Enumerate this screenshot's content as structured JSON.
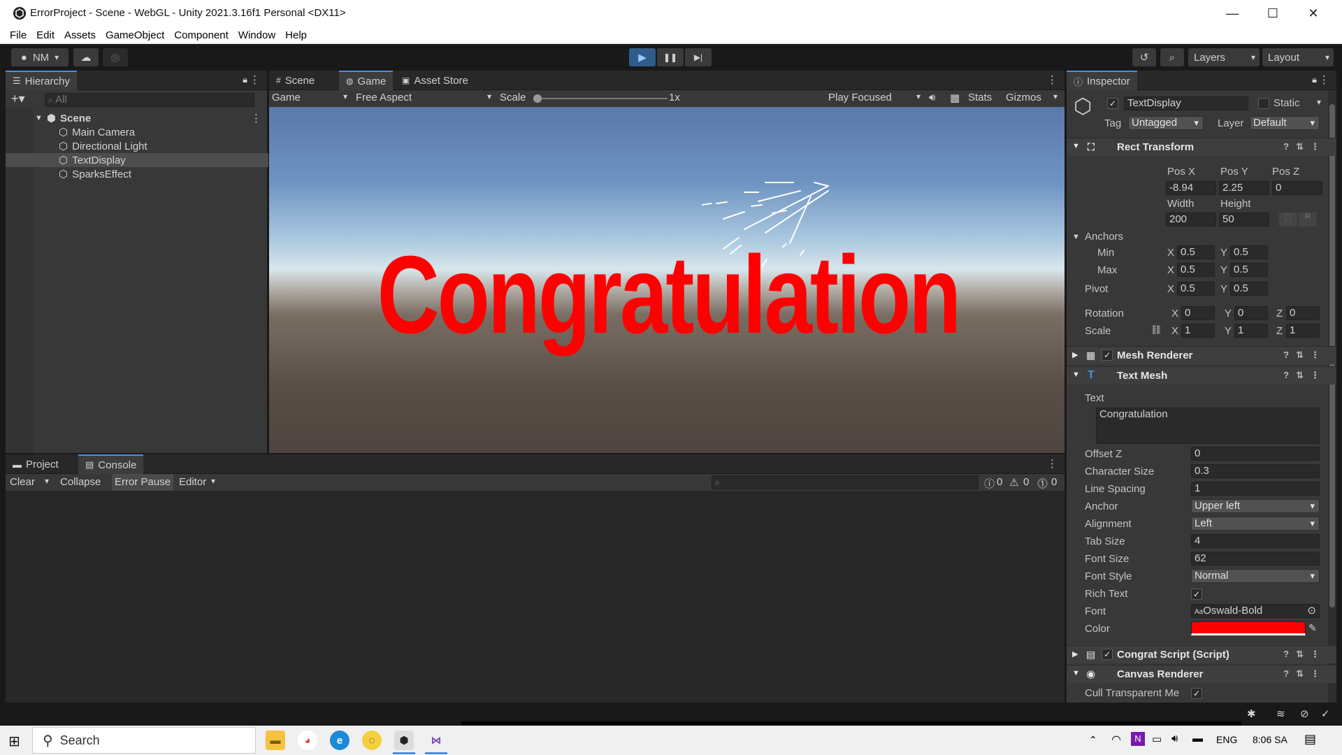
{
  "window": {
    "title": "ErrorProject - Scene - WebGL - Unity 2021.3.16f1 Personal <DX11>",
    "controls": {
      "minimize": "—",
      "maximize": "☐",
      "close": "✕"
    }
  },
  "menu": [
    "File",
    "Edit",
    "Assets",
    "GameObject",
    "Component",
    "Window",
    "Help"
  ],
  "toolbar": {
    "account": "NM",
    "layers": "Layers",
    "layout": "Layout",
    "play_icon": "▶",
    "pause_icon": "❚❚",
    "step_icon": "▶|"
  },
  "hierarchy": {
    "tab": "Hierarchy",
    "search_placeholder": "All",
    "scene": "Scene",
    "items": [
      "Main Camera",
      "Directional Light",
      "TextDisplay",
      "SparksEffect"
    ],
    "selected_index": 2
  },
  "game_view": {
    "tabs": [
      "Scene",
      "Game",
      "Asset Store"
    ],
    "active_tab": "Game",
    "display": "Game",
    "aspect": "Free Aspect",
    "scale_label": "Scale",
    "scale_value": "1x",
    "play_mode": "Play Focused",
    "stats": "Stats",
    "gizmos": "Gizmos",
    "rendered_text": "Congratulation"
  },
  "console": {
    "tabs": [
      "Project",
      "Console"
    ],
    "active_tab": "Console",
    "buttons": {
      "clear": "Clear",
      "collapse": "Collapse",
      "error_pause": "Error Pause",
      "editor": "Editor"
    },
    "counts": {
      "info": "0",
      "warning": "0",
      "error": "0"
    }
  },
  "inspector": {
    "tab": "Inspector",
    "object_name": "TextDisplay",
    "static_label": "Static",
    "tag_label": "Tag",
    "tag": "Untagged",
    "layer_label": "Layer",
    "layer": "Default",
    "rect_transform": {
      "title": "Rect Transform",
      "pos_x_label": "Pos X",
      "pos_y_label": "Pos Y",
      "pos_z_label": "Pos Z",
      "pos_x": "-8.94",
      "pos_y": "2.25",
      "pos_z": "0",
      "width_label": "Width",
      "height_label": "Height",
      "width": "200",
      "height": "50",
      "anchors_label": "Anchors",
      "min_label": "Min",
      "max_label": "Max",
      "min_x": "0.5",
      "min_y": "0.5",
      "max_x": "0.5",
      "max_y": "0.5",
      "pivot_label": "Pivot",
      "pivot_x": "0.5",
      "pivot_y": "0.5",
      "rotation_label": "Rotation",
      "rot_x": "0",
      "rot_y": "0",
      "rot_z": "0",
      "scale_label": "Scale",
      "scale_x": "1",
      "scale_y": "1",
      "scale_z": "1",
      "axis_x": "X",
      "axis_y": "Y",
      "axis_z": "Z"
    },
    "mesh_renderer": {
      "title": "Mesh Renderer"
    },
    "text_mesh": {
      "title": "Text Mesh",
      "text_label": "Text",
      "text": "Congratulation",
      "offset_z_label": "Offset Z",
      "offset_z": "0",
      "character_size_label": "Character Size",
      "character_size": "0.3",
      "line_spacing_label": "Line Spacing",
      "line_spacing": "1",
      "anchor_label": "Anchor",
      "anchor": "Upper left",
      "alignment_label": "Alignment",
      "alignment": "Left",
      "tab_size_label": "Tab Size",
      "tab_size": "4",
      "font_size_label": "Font Size",
      "font_size": "62",
      "font_style_label": "Font Style",
      "font_style": "Normal",
      "rich_text_label": "Rich Text",
      "font_label": "Font",
      "font": "Oswald-Bold",
      "color_label": "Color",
      "color": "#ff0000"
    },
    "congrat_script": {
      "title": "Congrat Script (Script)"
    },
    "canvas_renderer": {
      "title": "Canvas Renderer",
      "cull_label": "Cull Transparent Me"
    }
  },
  "taskbar": {
    "search": "Search",
    "lang": "ENG",
    "time": "8:06 SA"
  },
  "colors": {
    "accent": "#4a90e2",
    "text_color": "#ff0000"
  }
}
